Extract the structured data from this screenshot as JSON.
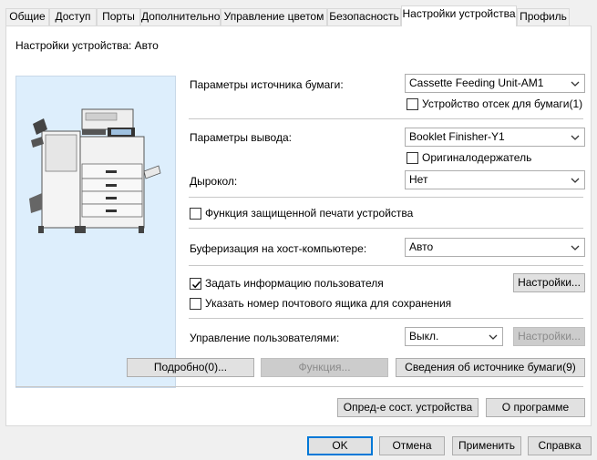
{
  "tabs": [
    {
      "label": "Общие"
    },
    {
      "label": "Доступ"
    },
    {
      "label": "Порты"
    },
    {
      "label": "Дополнительно"
    },
    {
      "label": "Управление цветом"
    },
    {
      "label": "Безопасность"
    },
    {
      "label": "Настройки устройства"
    },
    {
      "label": "Профиль"
    }
  ],
  "active_tab": "Настройки устройства",
  "device_settings_label": "Настройки устройства: Авто",
  "paper_source": {
    "label": "Параметры источника бумаги:",
    "value": "Cassette Feeding Unit-AM1",
    "checkbox_label": "Устройство отсек для бумаги(1)",
    "checked": false
  },
  "output": {
    "label": "Параметры вывода:",
    "value": "Booklet Finisher-Y1",
    "checkbox_label": "Оригиналодержатель",
    "checked": false
  },
  "punch": {
    "label": "Дырокол:",
    "value": "Нет"
  },
  "secure_print": {
    "label": "Функция защищенной печати устройства",
    "checked": false
  },
  "spooling": {
    "label": "Буферизация на хост-компьютере:",
    "value": "Авто"
  },
  "user_info": {
    "label": "Задать информацию пользователя",
    "checked": true,
    "settings_button": "Настройки..."
  },
  "mailbox": {
    "label": "Указать номер почтового ящика для сохранения",
    "checked": false
  },
  "user_management": {
    "label": "Управление пользователями:",
    "value": "Выкл.",
    "settings_button": "Настройки..."
  },
  "buttons": {
    "details": "Подробно(0)...",
    "function": "Функция...",
    "paper_source_info": "Сведения об источнике бумаги(9)",
    "detect_status": "Опред-е сост. устройства",
    "about": "О программе",
    "ok": "OK",
    "cancel": "Отмена",
    "apply": "Применить",
    "help": "Справка"
  }
}
